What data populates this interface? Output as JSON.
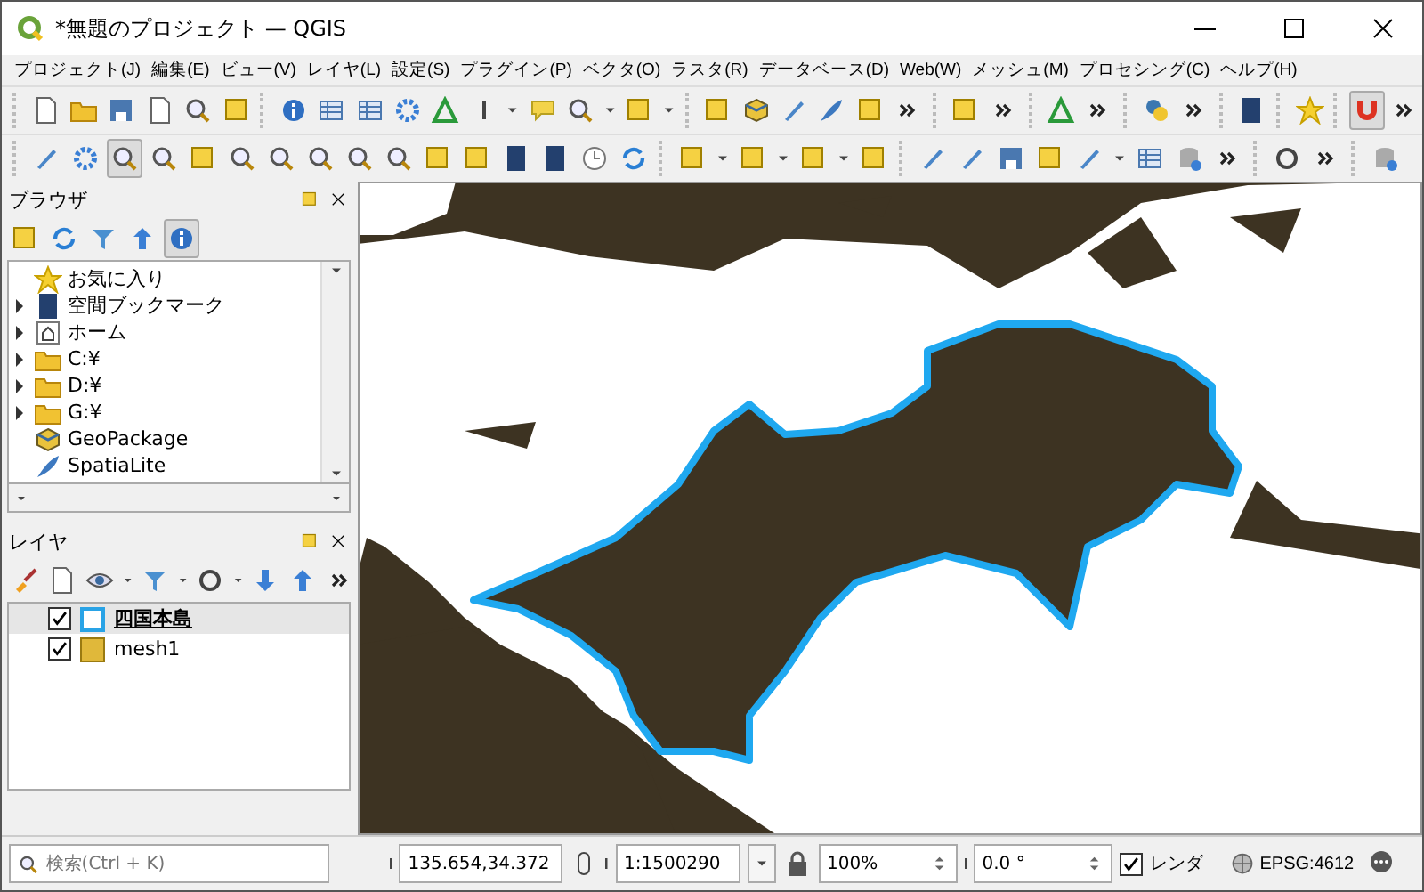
{
  "window": {
    "title": "*無題のプロジェクト — QGIS"
  },
  "menu": [
    "プロジェクト(J)",
    "編集(E)",
    "ビュー(V)",
    "レイヤ(L)",
    "設定(S)",
    "プラグイン(P)",
    "ベクタ(O)",
    "ラスタ(R)",
    "データベース(D)",
    "Web(W)",
    "メッシュ(M)",
    "プロセシング(C)",
    "ヘルプ(H)"
  ],
  "browser_panel": {
    "title": "ブラウザ",
    "items": [
      {
        "label": "お気に入り",
        "expandable": false
      },
      {
        "label": "空間ブックマーク",
        "expandable": true
      },
      {
        "label": "ホーム",
        "expandable": true
      },
      {
        "label": "C:¥",
        "expandable": true
      },
      {
        "label": "D:¥",
        "expandable": true
      },
      {
        "label": "G:¥",
        "expandable": true
      },
      {
        "label": "GeoPackage",
        "expandable": false
      },
      {
        "label": "SpatiaLite",
        "expandable": false
      }
    ]
  },
  "layers_panel": {
    "title": "レイヤ",
    "layers": [
      {
        "name": "四国本島",
        "checked": true,
        "selected": true,
        "kind": "outline",
        "color": "#29a3e6"
      },
      {
        "name": "mesh1",
        "checked": true,
        "selected": false,
        "kind": "fill",
        "color": "#e0b83a"
      }
    ]
  },
  "status_bar": {
    "search": {
      "placeholder": "検索(Ctrl + K)"
    },
    "coordinate": "135.654,34.372",
    "scale": "1:1500290",
    "magnifier": "100%",
    "rotation": "0.0 °",
    "render": {
      "label": "レンダ",
      "checked": true
    },
    "crs": "EPSG:4612"
  }
}
